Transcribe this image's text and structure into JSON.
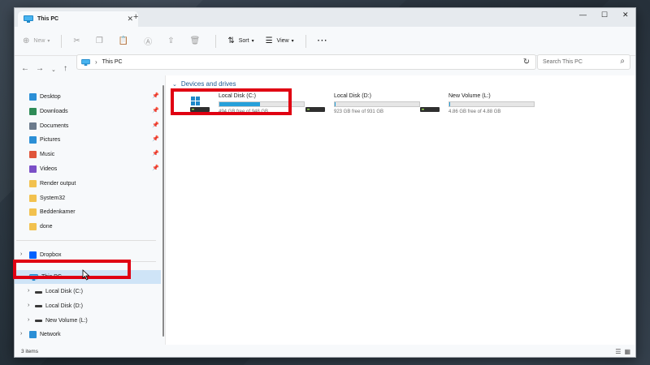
{
  "tab": {
    "title": "This PC"
  },
  "toolbar": {
    "new": "New",
    "sort": "Sort",
    "view": "View",
    "more": "···"
  },
  "address": {
    "path": "This PC",
    "separator": "›"
  },
  "search": {
    "placeholder": "Search This PC"
  },
  "sidebar": {
    "quick_access": [
      {
        "label": "Desktop",
        "icon": "desktop-icon",
        "color": "#2b8fd6",
        "pinned": true
      },
      {
        "label": "Downloads",
        "icon": "download-icon",
        "color": "#2e8b57",
        "pinned": true
      },
      {
        "label": "Documents",
        "icon": "document-icon",
        "color": "#6b7a8c",
        "pinned": true
      },
      {
        "label": "Pictures",
        "icon": "pictures-icon",
        "color": "#2b8fd6",
        "pinned": true
      },
      {
        "label": "Music",
        "icon": "music-icon",
        "color": "#e0543a",
        "pinned": true
      },
      {
        "label": "Videos",
        "icon": "videos-icon",
        "color": "#7b4fc7",
        "pinned": true
      },
      {
        "label": "Render output",
        "icon": "folder-icon",
        "color": "#f2c14e",
        "pinned": false
      },
      {
        "label": "System32",
        "icon": "folder-icon",
        "color": "#f2c14e",
        "pinned": false
      },
      {
        "label": "Beddenkamer",
        "icon": "folder-icon",
        "color": "#f2c14e",
        "pinned": false
      },
      {
        "label": "done",
        "icon": "folder-icon",
        "color": "#f2c14e",
        "pinned": false
      }
    ],
    "dropbox": {
      "label": "Dropbox"
    },
    "this_pc": {
      "label": "This PC"
    },
    "drives": [
      {
        "label": "Local Disk (C:)"
      },
      {
        "label": "Local Disk (D:)"
      },
      {
        "label": "New Volume (L:)"
      }
    ],
    "network": {
      "label": "Network"
    }
  },
  "content": {
    "section_title": "Devices and drives",
    "drives": [
      {
        "name": "Local Disk (C:)",
        "free": "494 GB free of 948 GB",
        "used_fraction": 0.48,
        "fill_color": "#26a0da"
      },
      {
        "name": "Local Disk (D:)",
        "free": "923 GB free of 931 GB",
        "used_fraction": 0.01,
        "fill_color": "#26a0da"
      },
      {
        "name": "New Volume (L:)",
        "free": "4.86 GB free of 4.88 GB",
        "used_fraction": 0.004,
        "fill_color": "#26a0da"
      }
    ]
  },
  "status": {
    "items": "3 items"
  },
  "colors": {
    "highlight": "#e00012",
    "accent": "#26a0da",
    "selection": "#cfe4f7"
  }
}
